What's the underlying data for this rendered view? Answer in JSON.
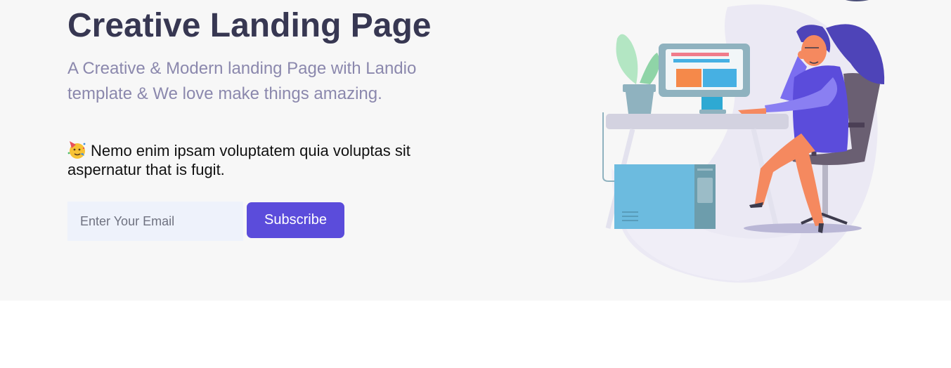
{
  "hero": {
    "title": "Creative Landing Page",
    "subtitle": "A Creative & Modern landing Page with Landio template & We love make things amazing.",
    "note": "Nemo enim ipsam voluptatem quia voluptas sit aspernatur that is fugit.",
    "note_icon": "party-face-icon"
  },
  "subscribe_form": {
    "email_placeholder": "Enter Your Email",
    "email_value": "",
    "button_label": "Subscribe"
  },
  "illustration": {
    "icon": "woman-at-desk-illustration"
  },
  "colors": {
    "hero_background": "#f7f7f7",
    "title": "#373752",
    "subtitle": "#8b88ad",
    "input_background": "#eef2fb",
    "button": "#5b4cdb"
  }
}
